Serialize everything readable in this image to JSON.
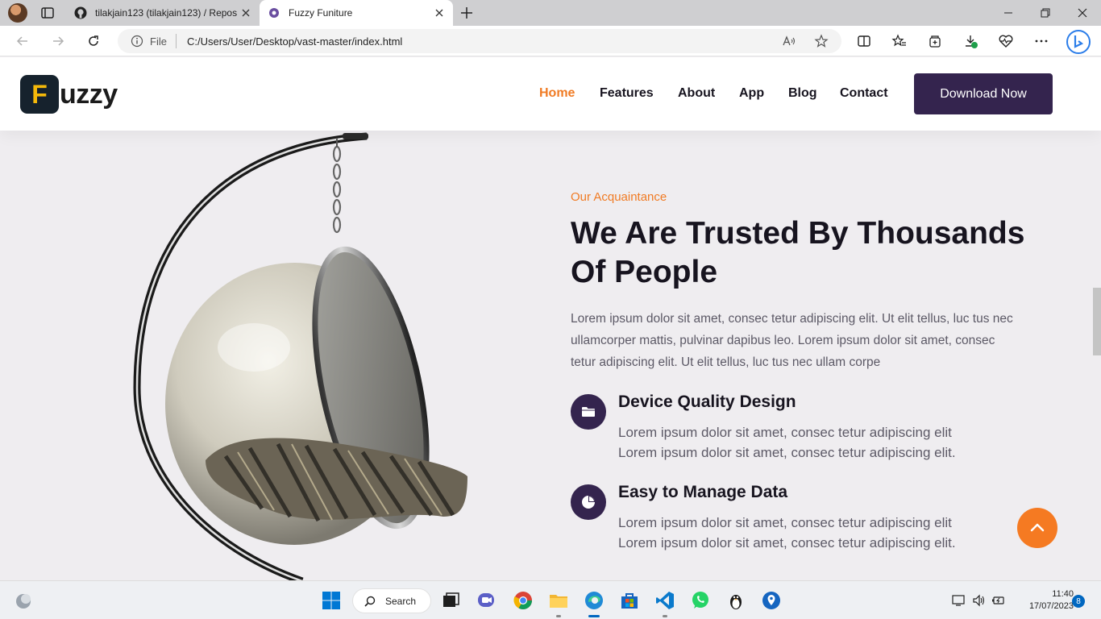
{
  "browser": {
    "tabs": [
      {
        "title": "tilakjain123 (tilakjain123) / Repos",
        "icon": "github-icon"
      },
      {
        "title": "Fuzzy Funiture",
        "icon": "site-favicon",
        "active": true
      }
    ],
    "address": {
      "scheme": "File",
      "url": "C:/Users/User/Desktop/vast-master/index.html"
    }
  },
  "site": {
    "logo": {
      "mark": "F",
      "word": "uzzy"
    },
    "nav": [
      {
        "label": "Home",
        "active": true
      },
      {
        "label": "Features"
      },
      {
        "label": "About"
      },
      {
        "label": "App"
      },
      {
        "label": "Blog"
      },
      {
        "label": "Contact"
      }
    ],
    "cta": "Download Now"
  },
  "about": {
    "eyebrow": "Our Acquaintance",
    "headline_line1": "We Are Trusted By Thousands",
    "headline_line2": "Of People",
    "lead": "Lorem ipsum dolor sit amet, consec tetur adipiscing elit. Ut elit tellus, luc tus nec ullamcorper mattis, pulvinar dapibus leo. Lorem ipsum dolor sit amet, consec tetur adipiscing elit. Ut elit tellus, luc tus nec ullam corpe",
    "features": [
      {
        "title": "Device Quality Design",
        "icon": "folder-icon",
        "line1": "Lorem ipsum dolor sit amet, consec tetur adipiscing elit",
        "line2": "Lorem ipsum dolor sit amet, consec tetur adipiscing elit."
      },
      {
        "title": "Easy to Manage Data",
        "icon": "pie-chart-icon",
        "line1": "Lorem ipsum dolor sit amet, consec tetur adipiscing elit",
        "line2": "Lorem ipsum dolor sit amet, consec tetur adipiscing elit."
      }
    ]
  },
  "taskbar": {
    "search_label": "Search",
    "time": "11:40",
    "date": "17/07/2023",
    "notifications": "8"
  },
  "colors": {
    "accent": "#f07b24",
    "brand_dark": "#34244e",
    "logo_bg": "#16222d",
    "logo_letter": "#f5b90a"
  }
}
